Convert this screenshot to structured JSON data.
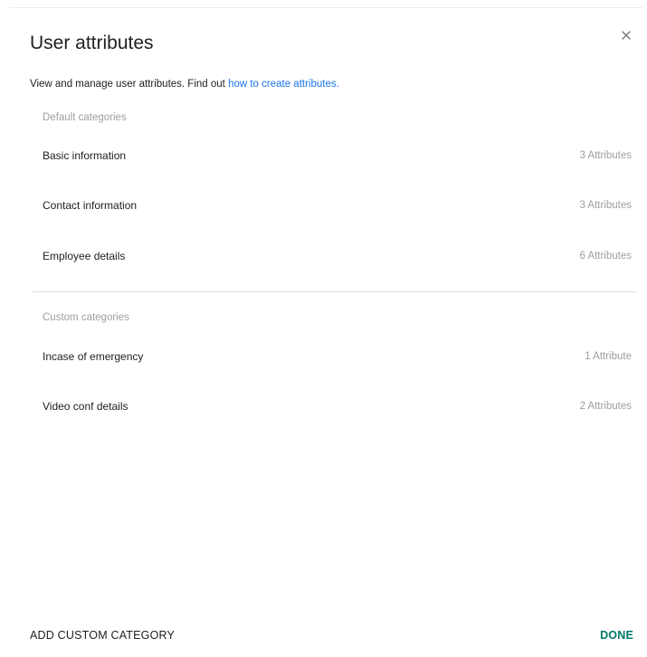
{
  "dialog": {
    "title": "User attributes",
    "close_icon": "close-icon",
    "description_text": "View and manage user attributes. Find out ",
    "description_link": "how to create attributes."
  },
  "default_section": {
    "label": "Default categories",
    "items": [
      {
        "label": "Basic information",
        "count": "3 Attributes"
      },
      {
        "label": "Contact information",
        "count": "3 Attributes"
      },
      {
        "label": "Employee details",
        "count": "6 Attributes"
      }
    ]
  },
  "custom_section": {
    "label": "Custom categories",
    "items": [
      {
        "label": "Incase of emergency",
        "count": "1 Attribute"
      },
      {
        "label": "Video conf details",
        "count": "2 Attributes"
      }
    ]
  },
  "footer": {
    "add_label": "ADD CUSTOM CATEGORY",
    "done_label": "DONE"
  },
  "colors": {
    "link": "#1a73e8",
    "done": "#00796b",
    "muted": "#9e9e9e",
    "text": "#212121"
  }
}
